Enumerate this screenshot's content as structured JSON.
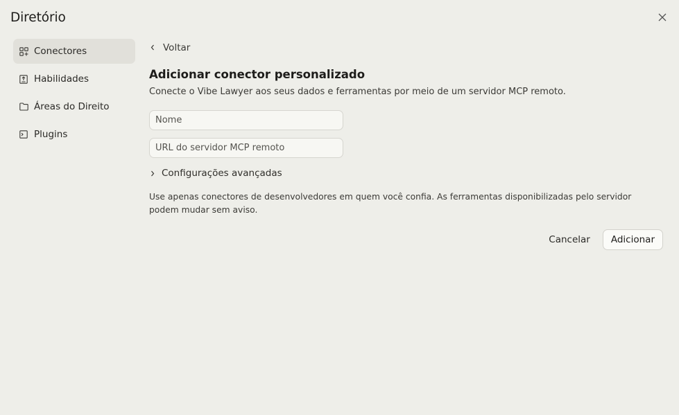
{
  "dialog": {
    "title": "Diretório"
  },
  "sidebar": {
    "items": [
      {
        "label": "Conectores",
        "icon": "grid-plus-icon",
        "active": true
      },
      {
        "label": "Habilidades",
        "icon": "document-upload-icon",
        "active": false
      },
      {
        "label": "Áreas do Direito",
        "icon": "folder-icon",
        "active": false
      },
      {
        "label": "Plugins",
        "icon": "terminal-icon",
        "active": false
      }
    ]
  },
  "main": {
    "back_label": "Voltar",
    "heading": "Adicionar conector personalizado",
    "subtitle": "Conecte o Vibe Lawyer aos seus dados e ferramentas por meio de um servidor MCP remoto.",
    "name_field": {
      "placeholder": "Nome",
      "value": ""
    },
    "url_field": {
      "placeholder": "URL do servidor MCP remoto",
      "value": ""
    },
    "advanced_label": "Configurações avançadas",
    "notice": "Use apenas conectores de desenvolvedores em quem você confia. As ferramentas disponibilizadas pelo servidor podem mudar sem aviso.",
    "cancel_label": "Cancelar",
    "add_label": "Adicionar"
  },
  "colors": {
    "background": "#eeeee9",
    "active_item": "#e1e0da",
    "input_bg": "#f7f7f3",
    "border": "#d6d5cf"
  }
}
